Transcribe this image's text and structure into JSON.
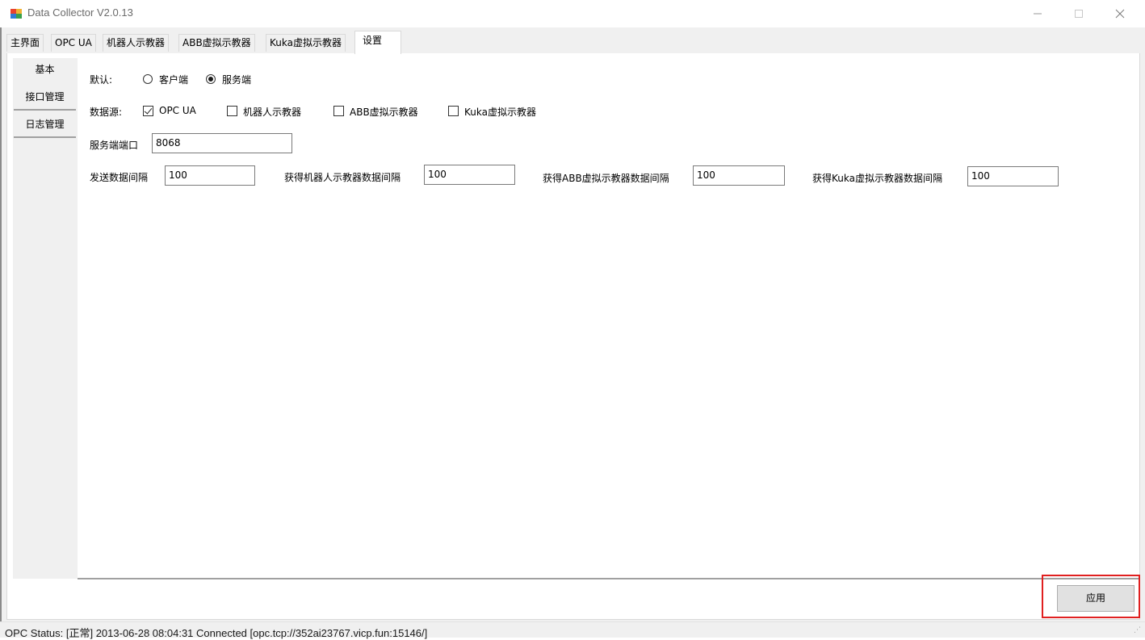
{
  "window": {
    "title": "Data Collector V2.0.13"
  },
  "tabs": [
    {
      "label": "主界面"
    },
    {
      "label": "OPC UA"
    },
    {
      "label": "机器人示教器"
    },
    {
      "label": "ABB虚拟示教器"
    },
    {
      "label": "Kuka虚拟示教器"
    },
    {
      "label": "设置",
      "active": true
    }
  ],
  "side_tabs": [
    {
      "label": "基本",
      "active": true
    },
    {
      "label": "接口管理"
    },
    {
      "label": "日志管理"
    }
  ],
  "settings": {
    "default_label": "默认:",
    "mode_options": [
      {
        "label": "客户端",
        "selected": false
      },
      {
        "label": "服务端",
        "selected": true
      }
    ],
    "datasource_label": "数据源:",
    "datasources": [
      {
        "label": "OPC UA",
        "checked": true
      },
      {
        "label": "机器人示教器",
        "checked": false
      },
      {
        "label": "ABB虚拟示教器",
        "checked": false
      },
      {
        "label": "Kuka虚拟示教器",
        "checked": false
      }
    ],
    "server_port_label": "服务端端口",
    "server_port_value": "8068",
    "send_interval_label": "发送数据间隔",
    "send_interval_value": "100",
    "robot_interval_label": "获得机器人示教器数据间隔",
    "robot_interval_value": "100",
    "abb_interval_label": "获得ABB虚拟示教器数据间隔",
    "abb_interval_value": "100",
    "kuka_interval_label": "获得Kuka虚拟示教器数据间隔",
    "kuka_interval_value": "100"
  },
  "apply_label": "应用",
  "status": {
    "text": "OPC Status:   [正常]  2013-06-28 08:04:31  Connected [opc.tcp://352ai23767.vicp.fun:15146/]"
  },
  "colors": {
    "highlight": "#e02020",
    "background": "#f0f0f0"
  }
}
